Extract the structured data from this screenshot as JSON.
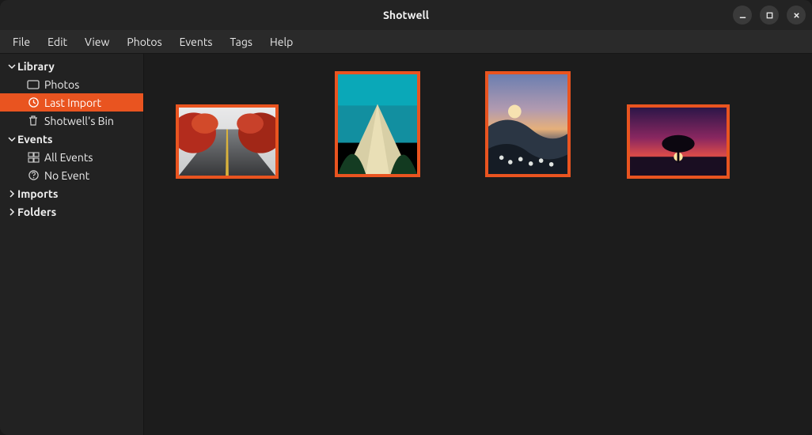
{
  "window": {
    "title": "Shotwell"
  },
  "menubar": {
    "items": [
      "File",
      "Edit",
      "View",
      "Photos",
      "Events",
      "Tags",
      "Help"
    ]
  },
  "sidebar": {
    "library": {
      "label": "Library",
      "photos": "Photos",
      "last_import": "Last Import",
      "bin": "Shotwell's Bin"
    },
    "events": {
      "label": "Events",
      "all_events": "All Events",
      "no_event": "No Event"
    },
    "imports": {
      "label": "Imports"
    },
    "folders": {
      "label": "Folders"
    }
  },
  "accent_color": "#e95420",
  "thumbnails": [
    {
      "orientation": "landscape",
      "selected": true
    },
    {
      "orientation": "portrait",
      "selected": true
    },
    {
      "orientation": "portrait",
      "selected": true
    },
    {
      "orientation": "landscape",
      "selected": true
    }
  ]
}
